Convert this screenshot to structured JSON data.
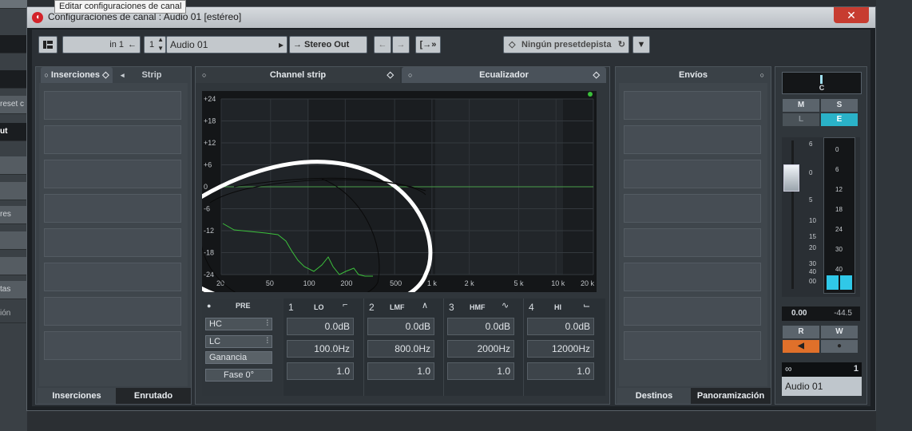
{
  "tooltip": "Editar configuraciones de canal",
  "window": {
    "title": "Configuraciones de canal : Audio 01 [estéreo]",
    "close_icon": "✕"
  },
  "background": {
    "left_rows": [
      "reset c",
      "ut",
      "res",
      "tas",
      "ión"
    ]
  },
  "toolbar": {
    "input": "in 1",
    "channel_number": "1",
    "channel_name": "Audio 01",
    "output": "Stereo Out",
    "preset": "Ningún presetdepista"
  },
  "inserts_panel": {
    "tab_inserts": "Inserciones",
    "tab_strip": "Strip",
    "bottom_inserts": "Inserciones",
    "bottom_routing": "Enrutado"
  },
  "center_panel": {
    "tab_channel_strip": "Channel strip",
    "tab_eq": "Ecualizador"
  },
  "eq": {
    "y_ticks": [
      "+24",
      "+18",
      "+12",
      "+6",
      "0",
      "-6",
      "-12",
      "-18",
      "-24"
    ],
    "x_ticks": [
      "20",
      "50",
      "100",
      "200",
      "500",
      "1 k",
      "2 k",
      "5 k",
      "10 k",
      "20 k"
    ],
    "pre_label": "PRE",
    "hc": "HC",
    "lc": "LC",
    "gain": "Ganancia",
    "phase": "Fase 0°",
    "bands": [
      {
        "number": "1",
        "name": "LO",
        "gain": "0.0dB",
        "freq": "100.0Hz",
        "q": "1.0"
      },
      {
        "number": "2",
        "name": "LMF",
        "gain": "0.0dB",
        "freq": "800.0Hz",
        "q": "1.0"
      },
      {
        "number": "3",
        "name": "HMF",
        "gain": "0.0dB",
        "freq": "2000Hz",
        "q": "1.0"
      },
      {
        "number": "4",
        "name": "HI",
        "gain": "0.0dB",
        "freq": "12000Hz",
        "q": "1.0"
      }
    ]
  },
  "sends_panel": {
    "tab_sends": "Envíos",
    "bottom_dest": "Destinos",
    "bottom_pan": "Panoramización"
  },
  "mixer": {
    "pan": "C",
    "mute": "M",
    "solo": "S",
    "listen": "L",
    "edit": "E",
    "fader_scale": [
      "6",
      "0",
      "5",
      "10",
      "15",
      "20",
      "30",
      "40",
      "00"
    ],
    "meter_scale": [
      "0",
      "6",
      "12",
      "18",
      "24",
      "30",
      "40"
    ],
    "volume": "0.00",
    "peak": "-44.5",
    "read": "R",
    "write": "W",
    "channel_index": "1",
    "channel_name": "Audio 01"
  }
}
